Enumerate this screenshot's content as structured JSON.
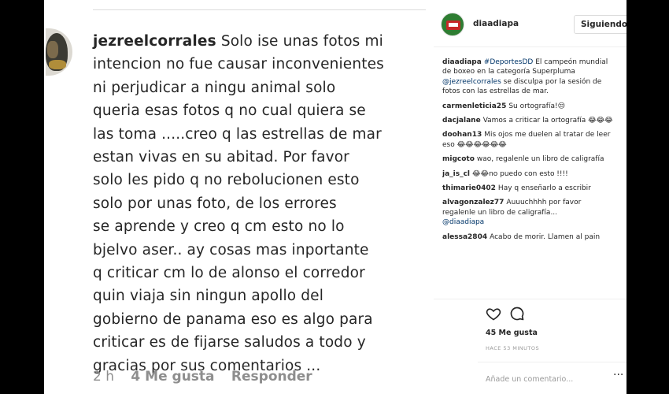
{
  "big_comment": {
    "username": "jezreelcorrales",
    "lines": [
      "Solo ise unas fotos mi",
      "intencion no fue causar inconvenientes",
      "ni perjudicar a ningu  animal solo",
      "queria esas fotos q no cual quiera se",
      "las toma .....creo q las estrellas de mar",
      "estan vivas en su abitad. Por favor",
      "solo les pido q no rebolucionen esto",
      "solo por unas foto,  de los errores",
      "se aprende y creo q cm esto no lo",
      "bjelvo aser.. ay cosas mas inportante",
      "q criticar cm lo de alonso el corredor",
      "quin viaja sin ningun apollo del",
      "gobierno de panama eso es algo para",
      "criticar es de fijarse saludos a todo y",
      "gracias por sus comentarios ..."
    ],
    "time": "2 h",
    "likes": "4 Me gusta",
    "reply": "Responder"
  },
  "post": {
    "username": "diaadiapa",
    "follow_label": "Siguiendo",
    "caption": {
      "user": "diaadiapa",
      "hashtag": "#DeportesDD",
      "text1": " El campeón mundial de boxeo en la categoría Superpluma ",
      "mention": "@jezreelcorrales",
      "text2": " se disculpa por la sesión de fotos con las estrellas de mar."
    },
    "comments": [
      {
        "user": "carmenleticia25",
        "text": "Su ortografía!😒"
      },
      {
        "user": "dacjalane",
        "text": "Vamos a criticar la ortografía 😂😂😂"
      },
      {
        "user": "doohan13",
        "text": "Mis ojos me duelen al tratar de leer eso 😂😂😂😂😂😂"
      },
      {
        "user": "migcoto",
        "text": "wao, regalenle un libro de caligrafía"
      },
      {
        "user": "ja_is_cl",
        "text": "😂😂no puedo con esto !!!!"
      },
      {
        "user": "thimarie0402",
        "text": "Hay q enseñarlo a escribir"
      },
      {
        "user": "alvagonzalez77",
        "text": "Auuuchhhh por favor regalenle un libro de caligrafía..."
      },
      {
        "user": "alessa2804",
        "text": "Acabo de morir. Llamen al pain"
      }
    ],
    "reply_tag": "@diaadiapa",
    "likes": "45 Me gusta",
    "time": "HACE 53 MINUTOS",
    "add_comment_placeholder": "Añade un comentario...",
    "options": "···"
  },
  "icons": {
    "heart": "heart-icon",
    "comment": "comment-icon",
    "options": "more-options-icon"
  }
}
